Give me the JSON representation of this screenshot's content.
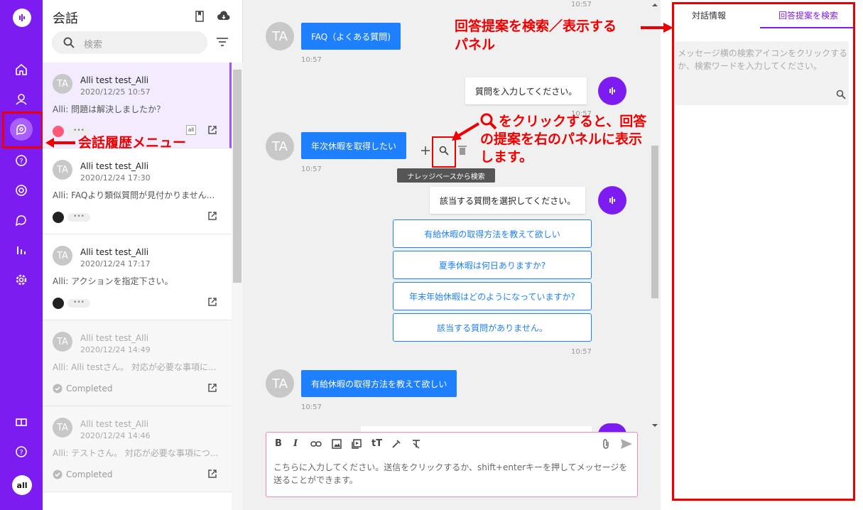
{
  "rail": {
    "items": [
      "home-icon",
      "contacts-icon",
      "conversations-icon",
      "help-icon",
      "target-icon",
      "chat-icon",
      "analytics-icon",
      "settings-icon"
    ],
    "bottom": [
      "gift-icon",
      "help-icon"
    ],
    "avatar_label": "all"
  },
  "conversations": {
    "title": "会話",
    "search_placeholder": "検索",
    "items": [
      {
        "avatar": "TA",
        "name": "Alli test test_Alli",
        "date": "2020/12/25 10:57",
        "preview": "Alli: 問題は解決しましたか？",
        "status": "",
        "selected": true
      },
      {
        "avatar": "TA",
        "name": "Alli test test_Alli",
        "date": "2020/12/24 17:30",
        "preview": "Alli: FAQより類似質問が見付かりません...",
        "status": "",
        "selected": false
      },
      {
        "avatar": "TA",
        "name": "Alli test test_Alli",
        "date": "2020/12/24 17:17",
        "preview": "Alli: アクションを指定下さい。",
        "status": "",
        "selected": false
      },
      {
        "avatar": "TA",
        "name": "Alli test test_Alli",
        "date": "2020/12/24 14:49",
        "preview": "Alli: Alli testさん。 対応が必要な事項に...",
        "status": "Completed",
        "selected": false
      },
      {
        "avatar": "TA",
        "name": "Alli test test_Alli",
        "date": "2020/12/24 14:46",
        "preview": "Alli: テストさん。 対応が必要な事項につ...",
        "status": "Completed",
        "selected": false
      }
    ],
    "badge_all": "all"
  },
  "chat": {
    "top_time": "10:57",
    "messages": [
      {
        "who": "user",
        "avatar": "TA",
        "text": "FAQ（よくある質問)",
        "time": "10:57"
      },
      {
        "who": "bot",
        "text": "質問を入力してください。",
        "time": "10:57"
      },
      {
        "who": "user",
        "avatar": "TA",
        "text": "年次休暇を取得したい",
        "time": "10:57"
      },
      {
        "who": "bot",
        "text": "該当する質問を選択してください。",
        "time": "10:57"
      },
      {
        "who": "user",
        "avatar": "TA",
        "text": "有給休暇の取得方法を教えて欲しい",
        "time": "10:57"
      }
    ],
    "options": [
      "有給休暇の取得方法を教えて欲しい",
      "夏季休暇は何日ありますか?",
      "年末年始休暇はどのようになっていますか?",
      "該当する質問がありません。"
    ],
    "tooltip": "ナレッジベースから検索",
    "composer_placeholder": "こちらに入力してください。送信をクリックするか、shift+enterキーを押してメッセージを送ることができます。"
  },
  "panel": {
    "tab_info": "対話情報",
    "tab_search": "回答提案を検索",
    "search_placeholder": "メッセージ横の検索アイコンをクリックするか、検索ワードを入力してください。"
  },
  "annotations": {
    "panel_note_line1": "回答提案を検索／表示する",
    "panel_note_line2": "パネル",
    "search_note_line1": "をクリックすると、回答",
    "search_note_line2": "の提案を右のパネルに表示",
    "search_note_line3": "します。",
    "menu_note": "会話履歴メニュー"
  },
  "colors": {
    "brand": "#7c1cf0",
    "user_bubble": "#1f80ff",
    "annotation": "#e00000"
  }
}
